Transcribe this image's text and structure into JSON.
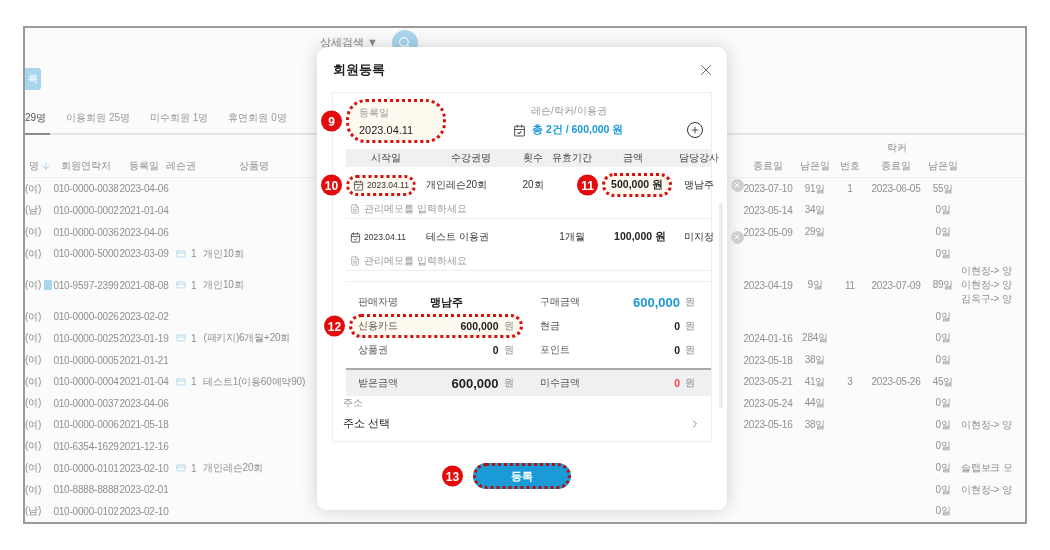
{
  "top_bar": {
    "detail_search": "상세검색",
    "dropdown_arrow": "▼"
  },
  "action_button": "록",
  "tabs": [
    {
      "label": "29명",
      "selected": true
    },
    {
      "label": "이용회원 25명",
      "selected": false
    },
    {
      "label": "미수회원 1명",
      "selected": false
    },
    {
      "label": "휴면회원 0명",
      "selected": false
    }
  ],
  "table": {
    "columns_left": [
      {
        "label": "명",
        "sorted": true
      },
      {
        "label": "회원연락처",
        "sorted": false
      },
      {
        "label": "등록일",
        "sorted": false
      },
      {
        "label": "레슨권",
        "sorted": false
      },
      {
        "label": "상품명",
        "sorted": false
      }
    ],
    "column_group": "락커",
    "columns_right": [
      {
        "label": "종료일"
      },
      {
        "label": "남은일"
      },
      {
        "label": "번호"
      },
      {
        "label": "종료일"
      },
      {
        "label": "남은일"
      }
    ],
    "rows": [
      {
        "member": "(여)",
        "badge": false,
        "phone": "010-0000-0038",
        "joined": "2023-04-06",
        "end": "2023-07-10",
        "remain": "91일",
        "locker_no": "1",
        "locker_end": "2023-06-05",
        "locker_remain": "55일"
      },
      {
        "member": "(남)",
        "badge": false,
        "phone": "010-0000-0002",
        "joined": "2021-01-04",
        "end": "2023-05-14",
        "remain": "34일",
        "locker_remain": "0일"
      },
      {
        "member": "(여)",
        "badge": false,
        "phone": "010-0000-0036",
        "joined": "2023-04-06",
        "end": "2023-05-09",
        "remain": "29일",
        "locker_remain": "0일"
      },
      {
        "member": "(여)",
        "badge": false,
        "phone": "010-0000-5000",
        "joined": "2023-03-09",
        "ticket": "1",
        "product": "개인10회",
        "locker_remain": "0일"
      },
      {
        "member": "(여)",
        "badge": true,
        "phone": "010-9597-2399",
        "joined": "2021-08-08",
        "ticket": "1",
        "product": "개인10회",
        "end": "2023-04-19",
        "remain": "9일",
        "locker_no": "11",
        "locker_end": "2023-07-09",
        "locker_remain": "89일",
        "memo": [
          "이현정-> 양",
          "이현정-> 양",
          "김옥구-> 양"
        ]
      },
      {
        "member": "(여)",
        "badge": false,
        "phone": "010-0000-0026",
        "joined": "2023-02-02",
        "locker_remain": "0일"
      },
      {
        "member": "(여)",
        "badge": false,
        "phone": "010-0000-0025",
        "joined": "2023-01-19",
        "ticket": "1",
        "product": "(패키지)6개월+20회",
        "end": "2024-01-16",
        "remain": "284일",
        "locker_remain": "0일"
      },
      {
        "member": "(여)",
        "badge": false,
        "phone": "010-0000-0005",
        "joined": "2021-01-21",
        "end": "2023-05-18",
        "remain": "38일",
        "locker_remain": "0일"
      },
      {
        "member": "(여)",
        "badge": false,
        "phone": "010-0000-0004",
        "joined": "2021-01-04",
        "ticket": "1",
        "product": "테스트1(이용60예약90)",
        "end": "2023-05-21",
        "remain": "41일",
        "locker_no": "3",
        "locker_end": "2023-05-26",
        "locker_remain": "45일"
      },
      {
        "member": "(여)",
        "badge": false,
        "phone": "010-0000-0037",
        "joined": "2023-04-06",
        "end": "2023-05-24",
        "remain": "44일",
        "locker_remain": "0일"
      },
      {
        "member": "(여)",
        "badge": false,
        "phone": "010-0000-0006",
        "joined": "2021-05-18",
        "end": "2023-05-16",
        "remain": "38일",
        "locker_remain": "0일",
        "memo": [
          "이현정-> 양"
        ]
      },
      {
        "member": "(여)",
        "badge": false,
        "phone": "010-6354-1629",
        "joined": "2021-12-16",
        "locker_remain": "0일"
      },
      {
        "member": "(여)",
        "badge": false,
        "phone": "010-0000-0101",
        "joined": "2023-02-10",
        "ticket": "1",
        "product": "개인레슨20회",
        "locker_remain": "0일",
        "memo": [
          "슬랩보크 모"
        ]
      },
      {
        "member": "(여)",
        "badge": false,
        "phone": "010-8888-8888",
        "joined": "2023-02-01",
        "locker_remain": "0일",
        "memo": [
          "이현정-> 양"
        ]
      },
      {
        "member": "(남)",
        "badge": false,
        "phone": "010-0000-0102",
        "joined": "2023-02-10",
        "locker_remain": "0일"
      }
    ]
  },
  "modal": {
    "title": "회원등록",
    "registration": {
      "label": "등록일",
      "value": "2023.04.11",
      "callout": "9"
    },
    "tickets_summary": {
      "label": "레슨/락커/이용권",
      "value": "총 2건 / 600,000 원"
    },
    "lesson_columns": [
      "시작일",
      "수강권명",
      "횟수",
      "유효기간",
      "금액",
      "담당강사"
    ],
    "lessons": [
      {
        "start": "2023.04.11",
        "name": "개인레슨20회",
        "count": "20회",
        "amount": "500,000",
        "unit": "원",
        "instructor": "맹남주",
        "memo_placeholder": "관리메모를 입력하세요",
        "callouts": {
          "start": "10",
          "amount": "11"
        }
      },
      {
        "start": "2023.04.11",
        "name": "테스트 이용권",
        "period": "1개월",
        "amount": "100,000",
        "unit": "원",
        "instructor": "미지정",
        "memo_placeholder": "관리메모를 입력하세요"
      }
    ],
    "payment": [
      {
        "kind": "name",
        "label": "판매자명",
        "value": "맹남주"
      },
      {
        "kind": "total",
        "label": "구매금액",
        "value": "600,000",
        "unit": "원"
      },
      {
        "kind": "amount",
        "label": "신용카드",
        "value": "600,000",
        "unit": "원",
        "callout": "12"
      },
      {
        "kind": "amount",
        "label": "현금",
        "value": "0",
        "unit": "원"
      },
      {
        "kind": "amount",
        "label": "상품권",
        "value": "0",
        "unit": "원"
      },
      {
        "kind": "amount",
        "label": "포인트",
        "value": "0",
        "unit": "원"
      }
    ],
    "settlement": [
      {
        "kind": "received",
        "label": "받은금액",
        "value": "600,000",
        "unit": "원"
      },
      {
        "kind": "outstanding",
        "label": "미수금액",
        "value": "0",
        "unit": "원"
      }
    ],
    "address": {
      "label": "주소",
      "value": "주소 선택"
    },
    "submit": {
      "label": "등록",
      "callout": "13"
    }
  }
}
